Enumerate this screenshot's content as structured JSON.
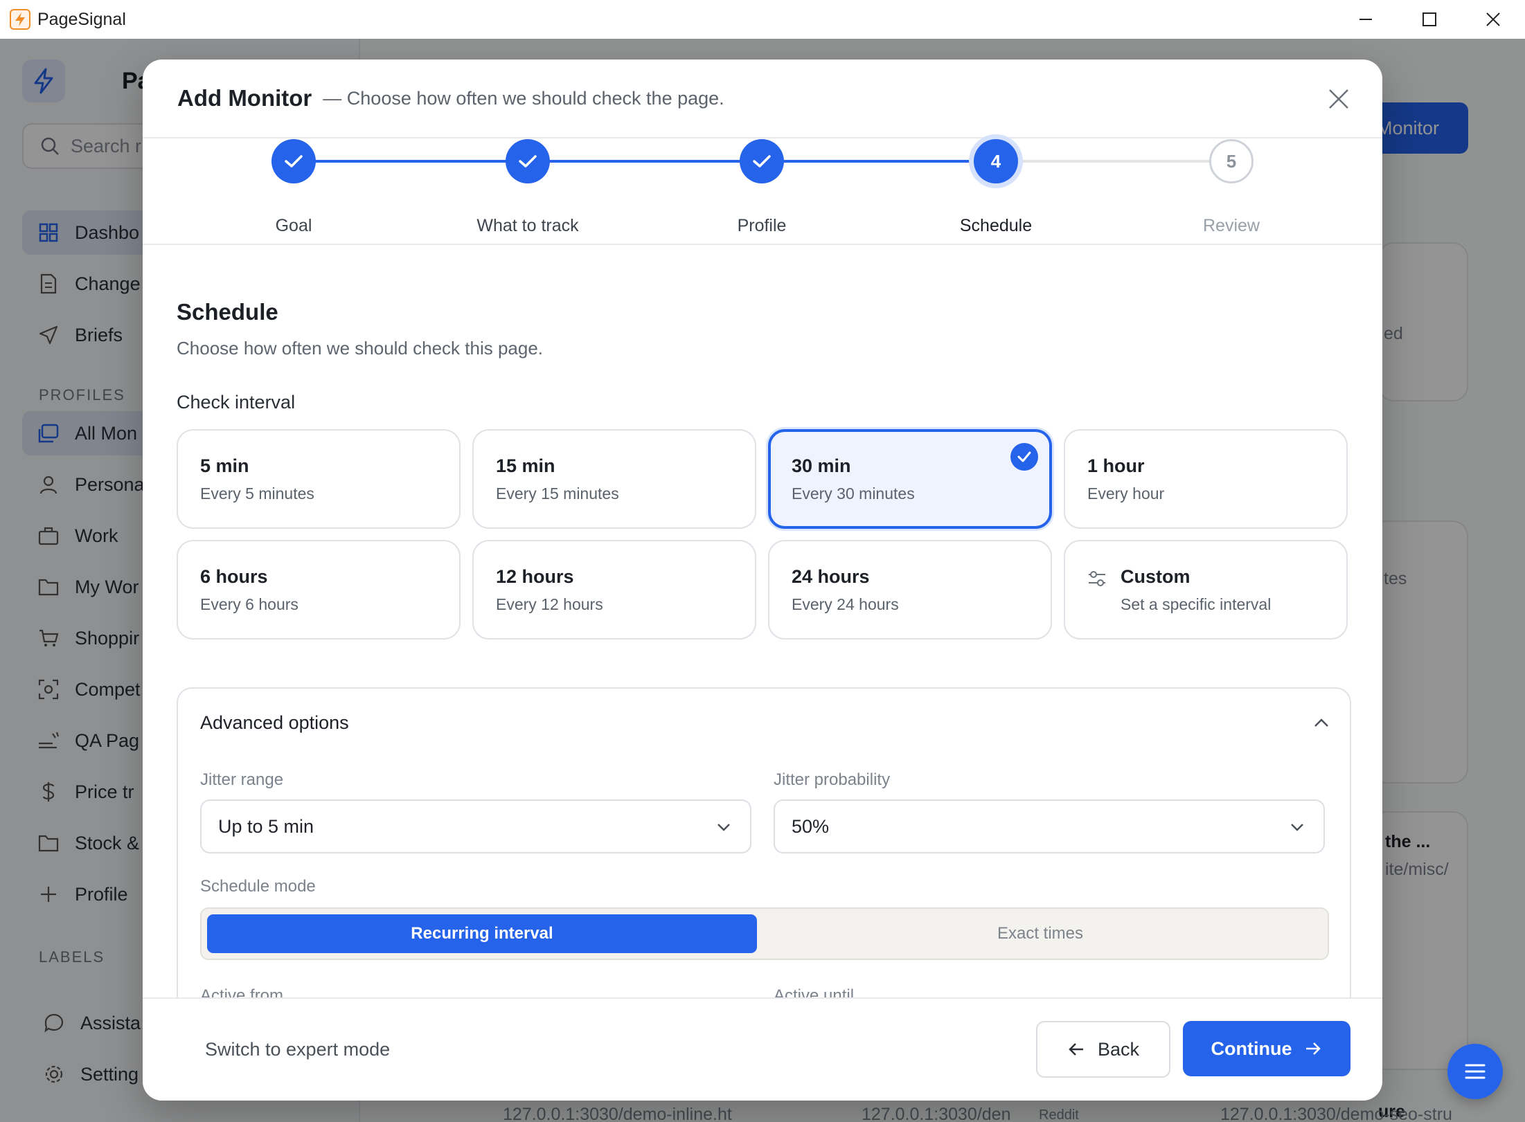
{
  "window": {
    "app_title": "PageSignal"
  },
  "background": {
    "brand": "Pa",
    "search_placeholder": "Search r",
    "nav": [
      {
        "label": "Dashbo",
        "icon": "grid-icon"
      },
      {
        "label": "Change",
        "icon": "document-icon"
      },
      {
        "label": "Briefs",
        "icon": "send-icon"
      }
    ],
    "profiles_label": "PROFILES",
    "profiles": [
      {
        "label": "All Mon",
        "icon": "folders-icon"
      },
      {
        "label": "Persona",
        "icon": "person-icon"
      },
      {
        "label": "Work",
        "icon": "briefcase-icon"
      },
      {
        "label": "My Wor",
        "icon": "folder-icon"
      },
      {
        "label": "Shoppir",
        "icon": "cart-icon"
      },
      {
        "label": "Compet",
        "icon": "scan-icon"
      },
      {
        "label": "QA Pag",
        "icon": "signal-icon"
      },
      {
        "label": "Price tr",
        "icon": "dollar-icon"
      },
      {
        "label": "Stock &",
        "icon": "folder-icon"
      },
      {
        "label": "Profile",
        "icon": "plus-icon"
      }
    ],
    "labels_label": "LABELS",
    "bottom_nav": [
      {
        "label": "Assista",
        "icon": "chat-icon"
      },
      {
        "label": "Setting",
        "icon": "gear-icon"
      }
    ],
    "add_monitor_button": "Monitor",
    "card_snippets": [
      "ed",
      "tes",
      "the ...",
      "ite/misc/",
      "ure"
    ],
    "url_snippets": [
      "127.0.0.1:3030/demo-inline.ht",
      "127.0.0.1:3030/den",
      "127.0.0.1:3030/demo-seo-stru"
    ],
    "badge_reddit": "Reddit"
  },
  "modal": {
    "title": "Add Monitor",
    "subtitle": "— Choose how often we should check the page.",
    "steps": [
      {
        "number": "1",
        "label": "Goal",
        "state": "done"
      },
      {
        "number": "2",
        "label": "What to track",
        "state": "done"
      },
      {
        "number": "3",
        "label": "Profile",
        "state": "done"
      },
      {
        "number": "4",
        "label": "Schedule",
        "state": "current"
      },
      {
        "number": "5",
        "label": "Review",
        "state": "todo"
      }
    ],
    "section_title": "Schedule",
    "section_desc": "Choose how often we should check this page.",
    "interval_label": "Check interval",
    "intervals": [
      {
        "title": "5 min",
        "desc": "Every 5 minutes"
      },
      {
        "title": "15 min",
        "desc": "Every 15 minutes"
      },
      {
        "title": "30 min",
        "desc": "Every 30 minutes",
        "selected": true
      },
      {
        "title": "1 hour",
        "desc": "Every hour"
      },
      {
        "title": "6 hours",
        "desc": "Every 6 hours"
      },
      {
        "title": "12 hours",
        "desc": "Every 12 hours"
      },
      {
        "title": "24 hours",
        "desc": "Every 24 hours"
      },
      {
        "title": "Custom",
        "desc": "Set a specific interval",
        "icon": "sliders-icon"
      }
    ],
    "advanced": {
      "title": "Advanced options",
      "jitter_range_label": "Jitter range",
      "jitter_range_value": "Up to 5 min",
      "jitter_probability_label": "Jitter probability",
      "jitter_probability_value": "50%",
      "schedule_mode_label": "Schedule mode",
      "mode_recurring": "Recurring interval",
      "mode_exact": "Exact times",
      "active_from_label": "Active from",
      "active_until_label": "Active until"
    },
    "footer": {
      "expert_mode": "Switch to expert mode",
      "back": "Back",
      "continue": "Continue"
    }
  },
  "colors": {
    "accent": "#2563eb",
    "selected_bg": "#eef3fe",
    "step_todo": "#cfd3d9"
  }
}
